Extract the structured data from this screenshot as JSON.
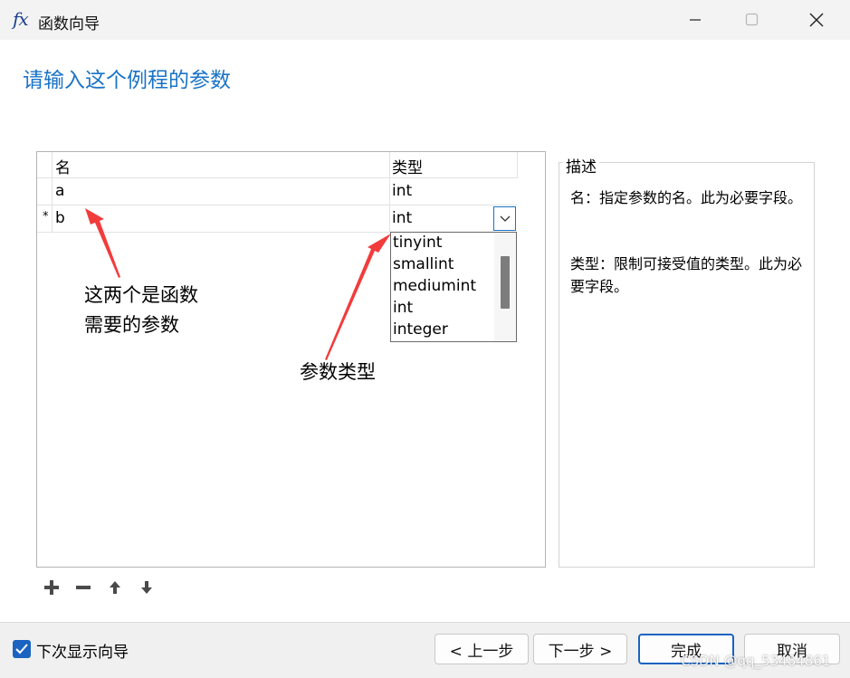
{
  "window": {
    "title": "函数向导",
    "icon": "fx-icon"
  },
  "heading": "请输入这个例程的参数",
  "grid": {
    "columns": [
      "名",
      "类型"
    ],
    "rows": [
      {
        "marker": "",
        "name": "a",
        "type": "int"
      },
      {
        "marker": "*",
        "name": "b",
        "type": "int"
      }
    ]
  },
  "dropdown": {
    "options": [
      "tinyint",
      "smallint",
      "mediumint",
      "int",
      "integer"
    ]
  },
  "annotations": {
    "params_line1": "这两个是函数",
    "params_line2": "需要的参数",
    "type": "参数类型"
  },
  "description": {
    "legend": "描述",
    "line1": "名：指定参数的名。此为必要字段。",
    "line2": "类型：限制可接受值的类型。此为必要字段。"
  },
  "footer": {
    "checkbox_label": "下次显示向导",
    "checkbox_checked": true,
    "back": "< 上一步",
    "next": "下一步 >",
    "finish": "完成",
    "cancel": "取消"
  },
  "watermark": "CSDN @qq_53484861",
  "colors": {
    "accent": "#1a73c6",
    "arrow": "#f23c3c"
  }
}
